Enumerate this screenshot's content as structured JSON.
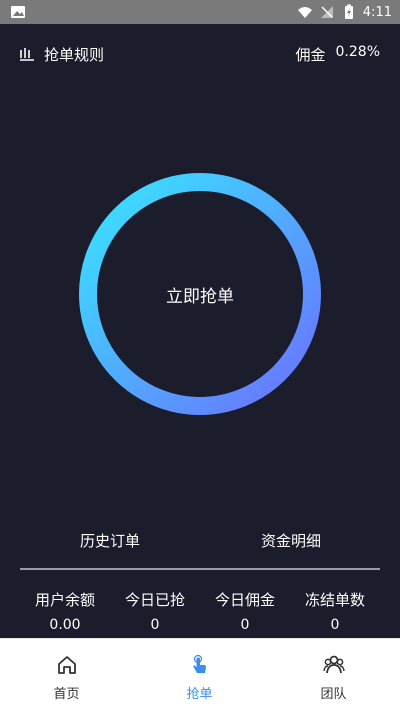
{
  "statusbar": {
    "time": "4:11"
  },
  "topbar": {
    "rules_label": "抢单规则",
    "commission_label": "佣金",
    "commission_value": "0.28%"
  },
  "main": {
    "grab_button_label": "立即抢单"
  },
  "links": {
    "history_orders": "历史订单",
    "fund_details": "资金明细"
  },
  "stats": [
    {
      "label": "用户余额",
      "value": "0.00"
    },
    {
      "label": "今日已抢",
      "value": "0"
    },
    {
      "label": "今日佣金",
      "value": "0"
    },
    {
      "label": "冻结单数",
      "value": "0"
    }
  ],
  "tabs": [
    {
      "label": "首页",
      "icon": "home-icon",
      "active": false
    },
    {
      "label": "抢单",
      "icon": "tap-hand-icon",
      "active": true
    },
    {
      "label": "团队",
      "icon": "team-icon",
      "active": false
    }
  ],
  "colors": {
    "background": "#1b1c2c",
    "ring_start": "#38e6ff",
    "ring_end": "#6b70ff",
    "active_tab": "#3a8df0"
  }
}
